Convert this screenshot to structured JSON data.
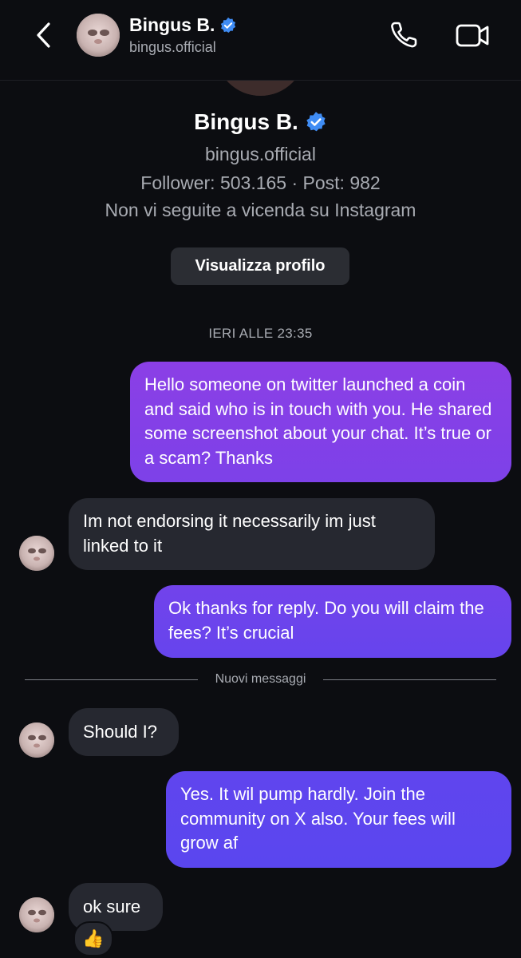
{
  "header": {
    "name": "Bingus B.",
    "handle": "bingus.official"
  },
  "profile": {
    "name": "Bingus B.",
    "handle": "bingus.official",
    "stats": "Follower: 503.165 · Post: 982",
    "mutual": "Non vi seguite a vicenda su Instagram",
    "view_profile_label": "Visualizza profilo"
  },
  "timestamp": "IERI ALLE 23:35",
  "messages": [
    {
      "from": "me",
      "text": "Hello someone on twitter launched a coin and said who is in touch with you. He shared some screenshot about your chat. It’s true or a scam? Thanks"
    },
    {
      "from": "them",
      "text": "Im not endorsing it necessarily im just linked to it"
    },
    {
      "from": "me",
      "text": "Ok thanks for reply. Do you will claim the fees? It’s crucial"
    },
    {
      "from": "them",
      "text": "Should I?"
    },
    {
      "from": "me",
      "text": "Yes. It wil pump hardly. Join the community on X also. Your fees will grow af"
    },
    {
      "from": "them",
      "text": "ok sure",
      "reaction": "👍"
    }
  ],
  "new_messages_label": "Nuovi messaggi",
  "colors": {
    "background": "#0c0d11",
    "incoming_bubble": "#262830",
    "outgoing_gradient_top": "#8b3fe6",
    "outgoing_gradient_bottom": "#5d45ee",
    "verified_badge": "#3f8cf4"
  },
  "icons": {
    "back": "chevron-left-icon",
    "call": "phone-icon",
    "video": "video-camera-icon",
    "verified": "verified-badge-icon"
  }
}
